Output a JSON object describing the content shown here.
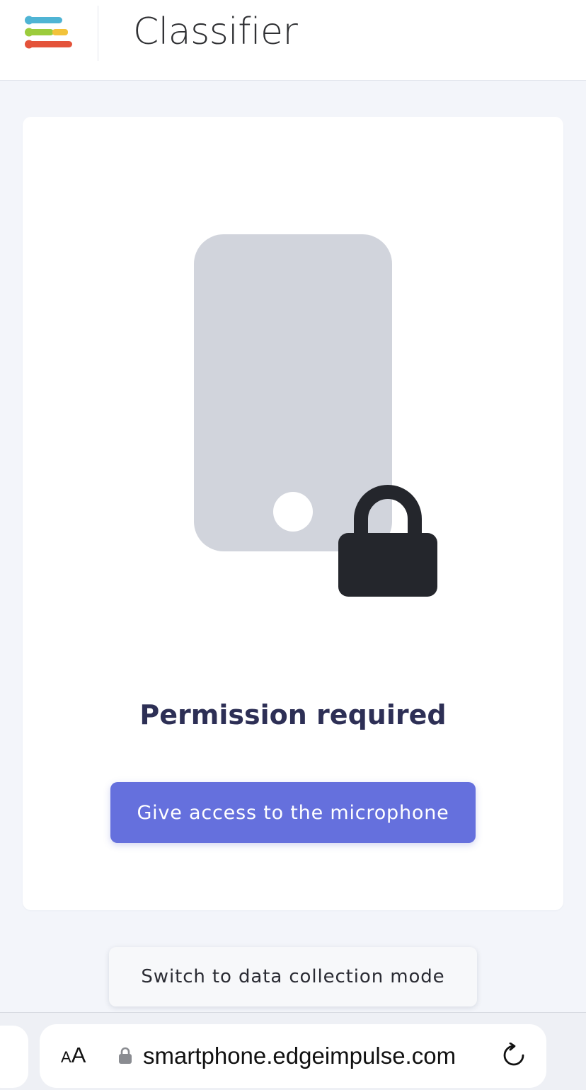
{
  "header": {
    "title": "Classifier",
    "logo_icon": "edge-impulse-logo",
    "logo_colors": [
      "#4fb4d4",
      "#9ccc3c",
      "#f2c33b",
      "#e4533a"
    ]
  },
  "permission": {
    "illustration_icons": [
      "phone-icon",
      "lock-icon"
    ],
    "title": "Permission required",
    "button_label": "Give access to the microphone"
  },
  "secondary": {
    "button_label": "Switch to data collection mode"
  },
  "browser": {
    "text_size_small": "A",
    "text_size_large": "A",
    "url": "smartphone.edgeimpulse.com",
    "secure_icon": "lock-icon",
    "reload_icon": "reload-icon"
  },
  "colors": {
    "accent": "#6570dd",
    "title": "#2d2f55",
    "background": "#f3f5fa"
  }
}
